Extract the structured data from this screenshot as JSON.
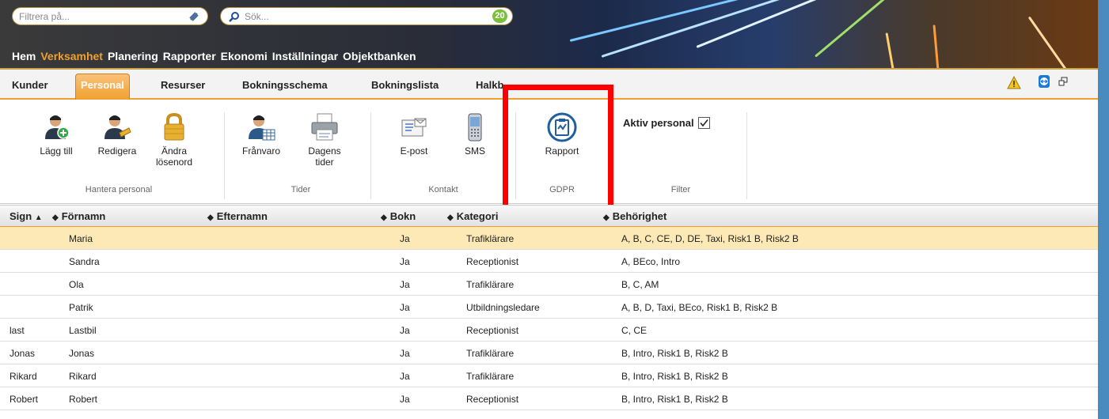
{
  "search": {
    "filter_placeholder": "Filtrera på...",
    "search_placeholder": "Sök...",
    "count": "20"
  },
  "main_nav": [
    "Hem",
    "Verksamhet",
    "Planering",
    "Rapporter",
    "Ekonomi",
    "Inställningar",
    "Objektbanken"
  ],
  "main_nav_active": "Verksamhet",
  "sub_tabs": [
    "Kunder",
    "Personal",
    "Resurser",
    "Bokningsschema",
    "Bokningslista",
    "Halkb"
  ],
  "sub_tab_active": "Personal",
  "ribbon": {
    "add": "Lägg till",
    "edit": "Redigera",
    "change_pw_1": "Ändra",
    "change_pw_2": "lösenord",
    "group_personal": "Hantera personal",
    "absence": "Frånvaro",
    "daily_1": "Dagens",
    "daily_2": "tider",
    "group_times": "Tider",
    "email": "E-post",
    "sms": "SMS",
    "group_contact": "Kontakt",
    "report": "Rapport",
    "group_gdpr": "GDPR",
    "active_staff": "Aktiv personal",
    "active_checked": true,
    "group_filter": "Filter"
  },
  "table": {
    "headers": {
      "sign": "Sign",
      "first": "Förnamn",
      "last": "Efternamn",
      "bookable": "Bokn",
      "category": "Kategori",
      "rights": "Behörighet"
    },
    "rows": [
      {
        "sign": "",
        "first": "Maria",
        "last": "",
        "bookable": "Ja",
        "category": "Trafiklärare",
        "rights": "A, B, C, CE, D, DE, Taxi, Risk1 B, Risk2 B",
        "selected": true
      },
      {
        "sign": "",
        "first": "Sandra",
        "last": "",
        "bookable": "Ja",
        "category": "Receptionist",
        "rights": "A, BEco, Intro"
      },
      {
        "sign": "",
        "first": "Ola",
        "last": "",
        "bookable": "Ja",
        "category": "Trafiklärare",
        "rights": "B, C, AM"
      },
      {
        "sign": "",
        "first": "Patrik",
        "last": "",
        "bookable": "Ja",
        "category": "Utbildningsledare",
        "rights": "A, B, D, Taxi, BEco, Risk1 B, Risk2 B"
      },
      {
        "sign": "last",
        "first": "Lastbil",
        "last": "",
        "bookable": "Ja",
        "category": "Receptionist",
        "rights": "C, CE"
      },
      {
        "sign": "Jonas",
        "first": "Jonas",
        "last": "",
        "bookable": "Ja",
        "category": "Trafiklärare",
        "rights": "B, Intro, Risk1 B, Risk2 B"
      },
      {
        "sign": "Rikard",
        "first": "Rikard",
        "last": "",
        "bookable": "Ja",
        "category": "Trafiklärare",
        "rights": "B, Intro, Risk1 B, Risk2 B"
      },
      {
        "sign": "Robert",
        "first": "Robert",
        "last": "",
        "bookable": "Ja",
        "category": "Receptionist",
        "rights": "B, Intro, Risk1 B, Risk2 B"
      }
    ]
  },
  "colors": {
    "accent": "#f0a030",
    "selected_row": "#fde9b5",
    "highlight": "#ff0000",
    "badge": "#7cbf3a"
  }
}
